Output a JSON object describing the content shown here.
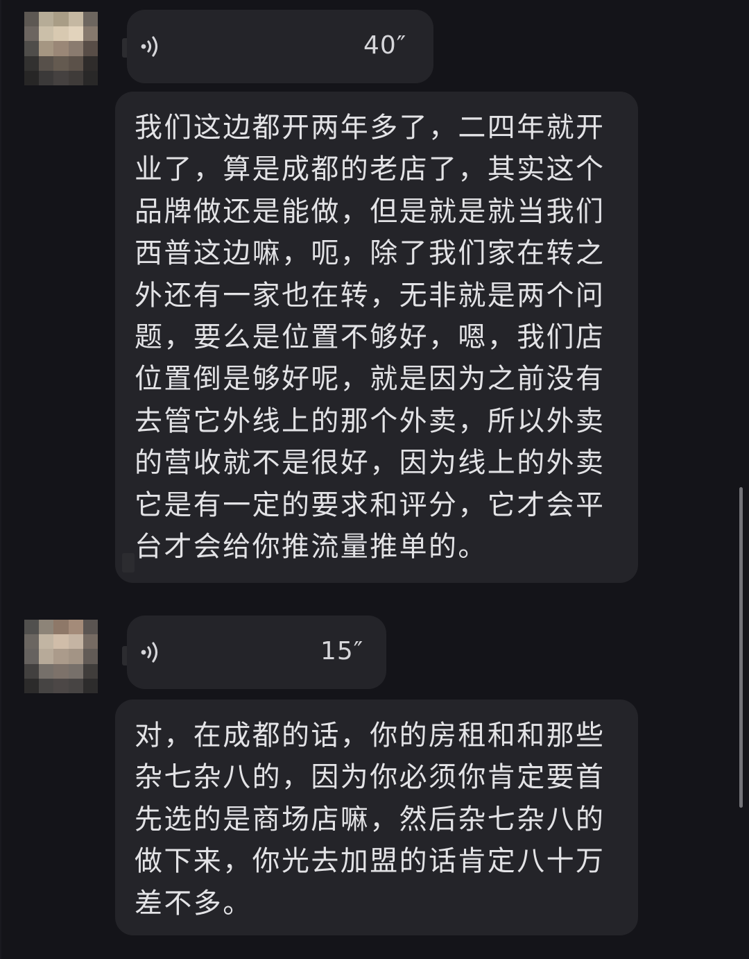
{
  "messages": [
    {
      "avatar": "blurred-avatar",
      "voice": {
        "duration": "40″"
      },
      "transcript": "我们这边都开两年多了，二四年就开业了，算是成都的老店了，其实这个品牌做还是能做，但是就是就当我们西普这边嘛，呃，除了我们家在转之外还有一家也在转，无非就是两个问题，要么是位置不够好，嗯，我们店位置倒是够好呢，就是因为之前没有去管它外线上的那个外卖，所以外卖的营收就不是很好，因为线上的外卖它是有一定的要求和评分，它才会平台才会给你推流量推单的。"
    },
    {
      "avatar": "blurred-avatar",
      "voice": {
        "duration": "15″"
      },
      "transcript": "对，在成都的话，你的房租和和那些杂七杂八的，因为你必须你肯定要首先选的是商场店嘛，然后杂七杂八的做下来，你光去加盟的话肯定八十万差不多。"
    }
  ],
  "icons": {
    "voice": "sound-wave-icon",
    "avatar": "pixelated-avatar"
  },
  "colors": {
    "background": "#141419",
    "bubble": "#242429",
    "text": "#e3e3e6"
  }
}
